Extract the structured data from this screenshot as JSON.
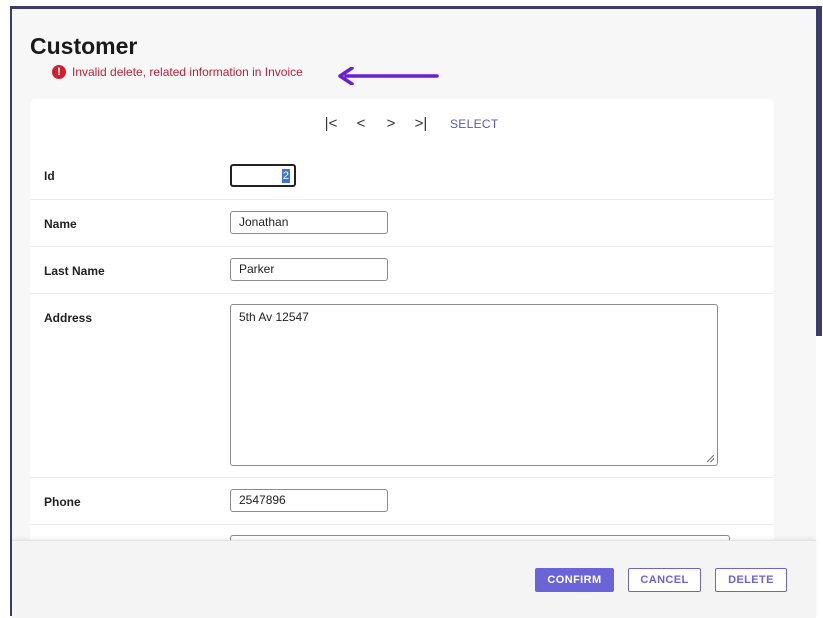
{
  "page": {
    "title": "Customer"
  },
  "error": {
    "icon": "exclamation-circle-icon",
    "message": "Invalid delete, related information in Invoice",
    "color": "#c2203a"
  },
  "annotation": {
    "arrow_color": "#6a1fd0"
  },
  "nav": {
    "first": "|<",
    "prev": "<",
    "next": ">",
    "last": ">|",
    "select_label": "SELECT"
  },
  "fields": {
    "id": {
      "label": "Id",
      "value": "2"
    },
    "name": {
      "label": "Name",
      "value": "Jonathan"
    },
    "last_name": {
      "label": "Last Name",
      "value": "Parker"
    },
    "address": {
      "label": "Address",
      "value": "5th Av 12547"
    },
    "phone": {
      "label": "Phone",
      "value": "2547896"
    }
  },
  "actions": {
    "confirm": "CONFIRM",
    "cancel": "CANCEL",
    "delete": "DELETE",
    "accent": "#6b63d8"
  }
}
